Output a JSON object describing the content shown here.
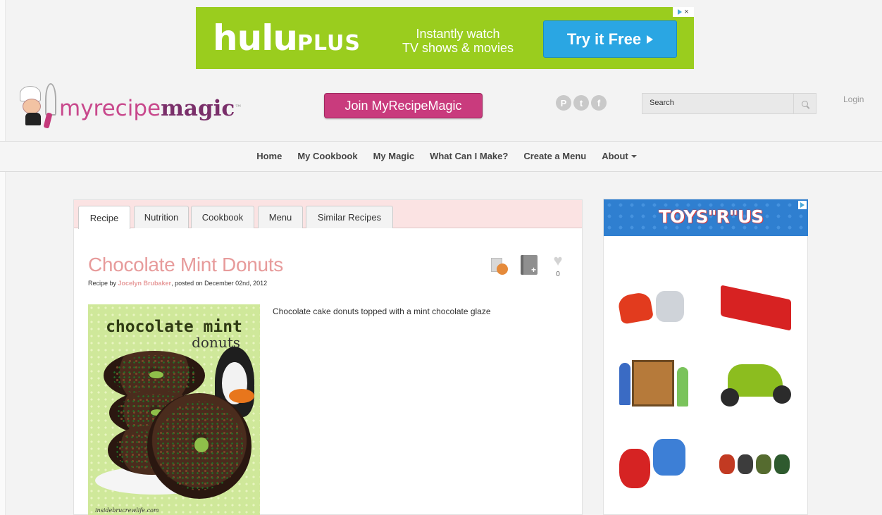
{
  "hulu_ad": {
    "logo_main": "hulu",
    "logo_plus": "PLUS",
    "tagline_1": "Instantly watch",
    "tagline_2": "TV shows & movies",
    "cta": "Try it Free",
    "adchoice_close": "×"
  },
  "header": {
    "logo_part1": "myrecipe",
    "logo_part2": "magic",
    "logo_tm": "™",
    "join_button": "Join MyRecipeMagic",
    "social": [
      {
        "glyph": "P",
        "icon": "pinterest-icon"
      },
      {
        "glyph": "t",
        "icon": "twitter-icon"
      },
      {
        "glyph": "f",
        "icon": "facebook-icon"
      }
    ],
    "search_placeholder": "Search",
    "login": "Login"
  },
  "nav": {
    "items": [
      "Home",
      "My Cookbook",
      "My Magic",
      "What Can I Make?",
      "Create a Menu",
      "About"
    ]
  },
  "recipe": {
    "tabs": [
      "Recipe",
      "Nutrition",
      "Cookbook",
      "Menu",
      "Similar Recipes"
    ],
    "active_tab": "Recipe",
    "title": "Chocolate Mint Donuts",
    "byline_prefix": "Recipe by ",
    "author": "Jocelyn Brubaker",
    "byline_suffix": ", posted on December 02nd, 2012",
    "heart_count": "0",
    "add_glyph": "+",
    "heart_glyph": "♥",
    "description": "Chocolate cake donuts topped with a mint chocolate glaze",
    "photo_title": "chocolate mint",
    "photo_subtitle": "donuts",
    "photo_credit": "insidebrucrewlife.com"
  },
  "side_ad": {
    "brand": "TOYS\"R\"US"
  }
}
